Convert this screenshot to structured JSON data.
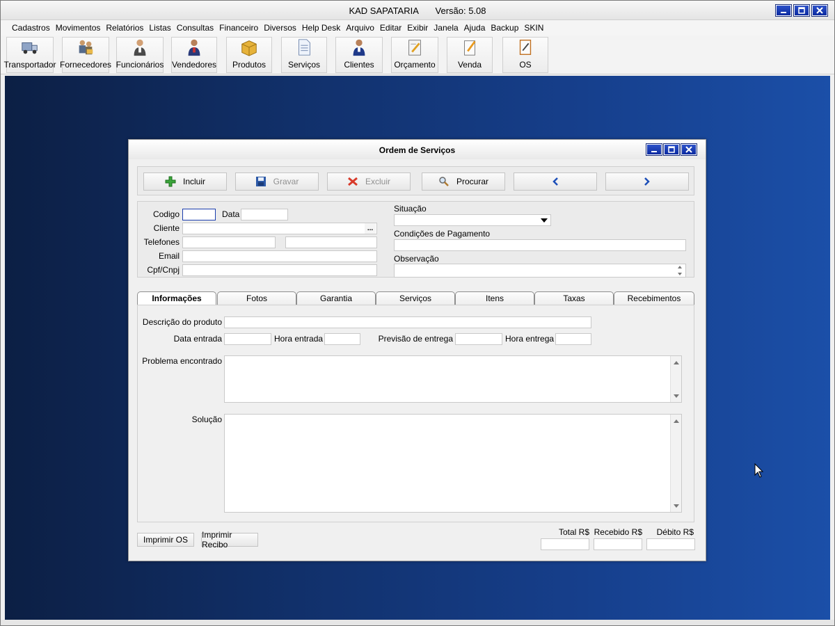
{
  "app": {
    "name": "KAD SAPATARIA",
    "version": "Versão: 5.08"
  },
  "menu": [
    "Cadastros",
    "Movimentos",
    "Relatórios",
    "Listas",
    "Consultas",
    "Financeiro",
    "Diversos",
    "Help Desk",
    "Arquivo",
    "Editar",
    "Exibir",
    "Janela",
    "Ajuda",
    "Backup",
    "SKIN"
  ],
  "toolbar": [
    {
      "label": "Transportador",
      "icon": "truck-icon"
    },
    {
      "label": "Fornecedores",
      "icon": "suppliers-icon"
    },
    {
      "label": "Funcionários",
      "icon": "employee-icon"
    },
    {
      "label": "Vendedores",
      "icon": "salesperson-icon"
    },
    {
      "label": "Produtos",
      "icon": "box-icon"
    },
    {
      "label": "Serviços",
      "icon": "document-icon"
    },
    {
      "label": "Clientes",
      "icon": "client-icon"
    },
    {
      "label": "Orçamento",
      "icon": "budget-icon"
    },
    {
      "label": "Venda",
      "icon": "sale-icon"
    },
    {
      "label": "OS",
      "icon": "os-icon"
    }
  ],
  "os_window": {
    "title": "Ordem de Serviços",
    "actions": {
      "incluir": "Incluir",
      "gravar": "Gravar",
      "excluir": "Excluir",
      "procurar": "Procurar"
    },
    "form": {
      "codigo_label": "Codigo",
      "data_label": "Data",
      "cliente_label": "Cliente",
      "cliente_lookup": "...",
      "telefones_label": "Telefones",
      "email_label": "Email",
      "cpf_label": "Cpf/Cnpj",
      "situacao_label": "Situação",
      "condicoes_label": "Condições de Pagamento",
      "observacao_label": "Observação"
    },
    "tabs": [
      "Informações",
      "Fotos",
      "Garantia",
      "Serviços",
      "Itens",
      "Taxas",
      "Recebimentos"
    ],
    "info": {
      "descricao_label": "Descrição do produto",
      "data_entrada_label": "Data entrada",
      "hora_entrada_label": "Hora entrada",
      "previsao_label": "Previsão de entrega",
      "hora_entrega_label": "Hora entrega",
      "problema_label": "Problema encontrado",
      "solucao_label": "Solução"
    },
    "footer": {
      "imprimir_os": "Imprimir OS",
      "imprimir_recibo": "Imprimir Recibo",
      "total_label": "Total R$",
      "recebido_label": "Recebido R$",
      "debito_label": "Débito R$"
    }
  }
}
